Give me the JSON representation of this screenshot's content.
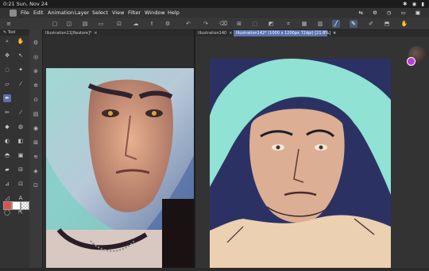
{
  "status": {
    "time": "0:21 Sun, Nov 24"
  },
  "menu": [
    "File",
    "Edit",
    "Animation",
    "Layer",
    "Select",
    "View",
    "Filter",
    "Window",
    "Help"
  ],
  "left_panel_title": "Tool",
  "tabs": [
    {
      "label": "Illustration11[Restore]*",
      "close": "×"
    },
    {
      "label": "Illustration140",
      "close": "×"
    },
    {
      "label": "Illustration142* (1000 x 1200px 72dpi) [21.8%]",
      "close": "×"
    }
  ],
  "icons": {
    "menu": "≡",
    "left_tools": [
      "brush",
      "hand",
      "zoom",
      "move",
      "lasso",
      "eyedropper",
      "pencil",
      "pen",
      "eraser",
      "fill",
      "airbrush",
      "blend",
      "text",
      "figure",
      "ruler",
      "gradient",
      "frame",
      "balloon",
      "correction",
      "subview"
    ],
    "sub_tools": [
      "settings",
      "layers",
      "navigator",
      "info",
      "history",
      "materials",
      "animation",
      "auto-action"
    ]
  },
  "colors": {
    "accent": "#5a74b0",
    "main_color": "#d9534f",
    "sub_color": "#ffffff"
  }
}
